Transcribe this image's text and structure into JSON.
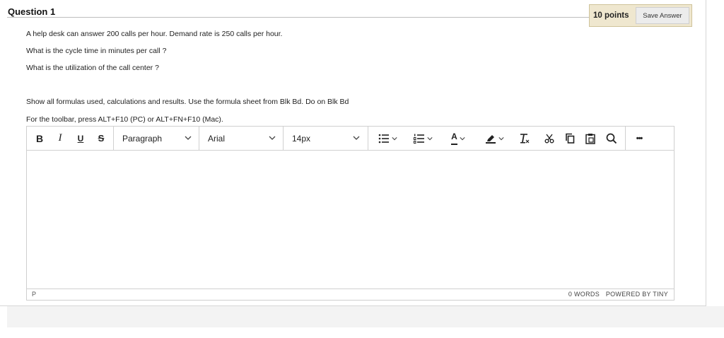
{
  "question": {
    "title": "Question 1",
    "points": "10 points",
    "save_label": "Save Answer",
    "lines": [
      "A help desk can answer 200 calls per hour. Demand rate is 250 calls per hour.",
      "What is the cycle time in minutes per call ?",
      "What is the utilization of the call center ?",
      "Show all formulas used, calculations and results. Use the formula sheet from Blk Bd. Do on Blk Bd",
      "For the toolbar, press ALT+F10 (PC) or ALT+FN+F10 (Mac)."
    ]
  },
  "editor": {
    "toolbar": {
      "bold": "B",
      "italic": "I",
      "underline": "U",
      "strike": "S",
      "block_format": "Paragraph",
      "font_family": "Arial",
      "font_size": "14px",
      "font_color_letter": "A",
      "more": "•••"
    },
    "status": {
      "path": "P",
      "word_count": "0 WORDS",
      "powered_by": "POWERED BY TINY"
    }
  },
  "colors": {
    "points_bg": "#efe7cf",
    "font_color_bar": "#d32f2f",
    "highlight_bar": "#222222"
  },
  "icons": [
    "bold-icon",
    "italic-icon",
    "underline-icon",
    "strikethrough-icon",
    "bullet-list-icon",
    "numbered-list-icon",
    "font-color-icon",
    "highlight-icon",
    "clear-format-icon",
    "cut-icon",
    "copy-icon",
    "paste-icon",
    "search-icon",
    "more-icon"
  ]
}
